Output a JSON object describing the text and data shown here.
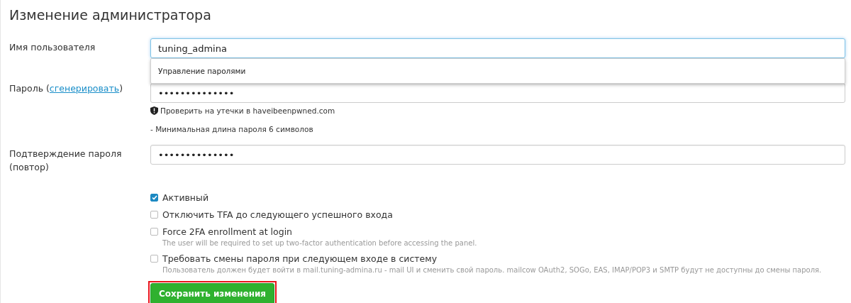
{
  "title": "Изменение администратора",
  "username": {
    "label": "Имя пользователя",
    "value": "tuning_admina",
    "focused": true
  },
  "autocomplete": {
    "item": "Управление паролями"
  },
  "password": {
    "label_before": "Пароль (",
    "label_link": "сгенерировать",
    "label_after": ")",
    "value": "••••••••••••••"
  },
  "leak_check": "Проверить на утечки в haveibeenpwned.com",
  "min_length": "- Минимальная длина пароля 6 символов",
  "confirm": {
    "label": "Подтверждение пароля (повтор)",
    "value": "••••••••••••••"
  },
  "options": [
    {
      "label": "Активный",
      "checked": true
    },
    {
      "label": "Отключить TFA до следующего успешного входа",
      "checked": false
    },
    {
      "label": "Force 2FA enrollment at login",
      "checked": false,
      "help": "The user will be required to set up two-factor authentication before accessing the panel."
    },
    {
      "label": "Требовать смены пароля при следующем входе в систему",
      "checked": false,
      "help": "Пользователь должен будет войти в mail.tuning-admina.ru - mail UI и сменить свой пароль. mailcow OAuth2, SOGo, EAS, IMAP/POP3 и SMTP будут не доступны до смены пароля."
    }
  ],
  "save_button": {
    "label": "Сохранить изменения",
    "highlighted": true
  }
}
